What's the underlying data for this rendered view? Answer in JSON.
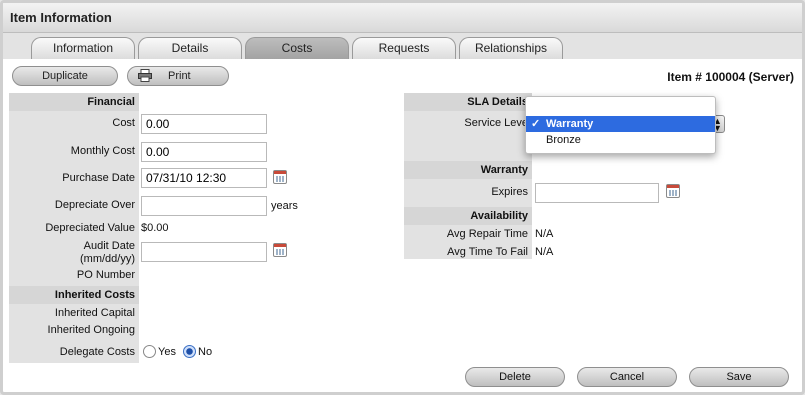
{
  "header": {
    "title": "Item Information"
  },
  "tabs": [
    {
      "label": "Information"
    },
    {
      "label": "Details"
    },
    {
      "label": "Costs"
    },
    {
      "label": "Requests"
    },
    {
      "label": "Relationships"
    }
  ],
  "toolbar": {
    "duplicate_label": "Duplicate",
    "print_label": "Print",
    "item_id": "Item # 100004 (Server)"
  },
  "financial": {
    "section": "Financial",
    "cost_label": "Cost",
    "cost_value": "0.00",
    "monthly_label": "Monthly Cost",
    "monthly_value": "0.00",
    "purchase_label": "Purchase Date",
    "purchase_value": "07/31/10 12:30",
    "depreciate_label": "Depreciate Over",
    "depreciate_value": "",
    "depreciate_unit": "years",
    "depreciated_label": "Depreciated Value",
    "depreciated_value": "$0.00",
    "audit_label_1": "Audit Date",
    "audit_label_2": "(mm/dd/yy)",
    "audit_value": "",
    "po_label": "PO Number"
  },
  "inherited": {
    "section": "Inherited Costs",
    "capital_label": "Inherited Capital",
    "ongoing_label": "Inherited Ongoing",
    "delegate_label": "Delegate Costs",
    "yes_label": "Yes",
    "no_label": "No",
    "selected": "No"
  },
  "sla": {
    "section": "SLA Details",
    "service_level_label": "Service Leve",
    "options": [
      {
        "label": "Warranty",
        "selected": true
      },
      {
        "label": "Bronze",
        "selected": false
      }
    ],
    "checkmark": "✓"
  },
  "warranty": {
    "section": "Warranty",
    "expires_label": "Expires",
    "expires_value": ""
  },
  "availability": {
    "section": "Availability",
    "repair_label": "Avg Repair Time",
    "repair_value": "N/A",
    "fail_label": "Avg Time To Fail",
    "fail_value": "N/A"
  },
  "footer": {
    "delete_label": "Delete",
    "cancel_label": "Cancel",
    "save_label": "Save"
  },
  "colors": {
    "selection": "#2d6be0",
    "label_bg": "#e2e2e2",
    "section_bg": "#d6d6d6"
  }
}
